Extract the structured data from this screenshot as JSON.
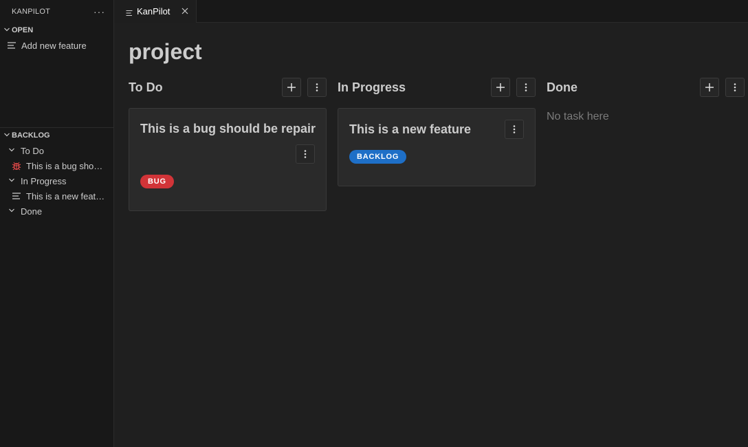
{
  "sidebar": {
    "title": "KANPILOT",
    "more_label": "···",
    "open": {
      "header": "OPEN",
      "items": [
        {
          "label": "Add new feature",
          "icon": "lines-icon"
        }
      ]
    },
    "backlog": {
      "header": "BACKLOG",
      "groups": [
        {
          "label": "To Do",
          "items": [
            {
              "label": "This is a bug should be repair",
              "icon": "bug-icon"
            }
          ]
        },
        {
          "label": "In Progress",
          "items": [
            {
              "label": "This is a new feature",
              "icon": "lines-icon"
            }
          ]
        },
        {
          "label": "Done",
          "items": []
        }
      ]
    }
  },
  "tab": {
    "label": "KanPilot",
    "icon": "lines-icon",
    "close_icon": "close-icon"
  },
  "board": {
    "title": "project",
    "columns": [
      {
        "title": "To Do",
        "cards": [
          {
            "title": "This is a bug should be repair",
            "badge": "BUG",
            "badge_color": "#d13438"
          }
        ]
      },
      {
        "title": "In Progress",
        "cards": [
          {
            "title": "This is a new feature",
            "badge": "BACKLOG",
            "badge_color": "#1e6fc7"
          }
        ]
      },
      {
        "title": "Done",
        "cards": [],
        "empty_text": "No task here"
      }
    ]
  },
  "colors": {
    "background": "#1f1f1f",
    "sidebar": "#181818",
    "card": "#2a2a2a",
    "bug": "#d13438",
    "backlog": "#1e6fc7"
  }
}
